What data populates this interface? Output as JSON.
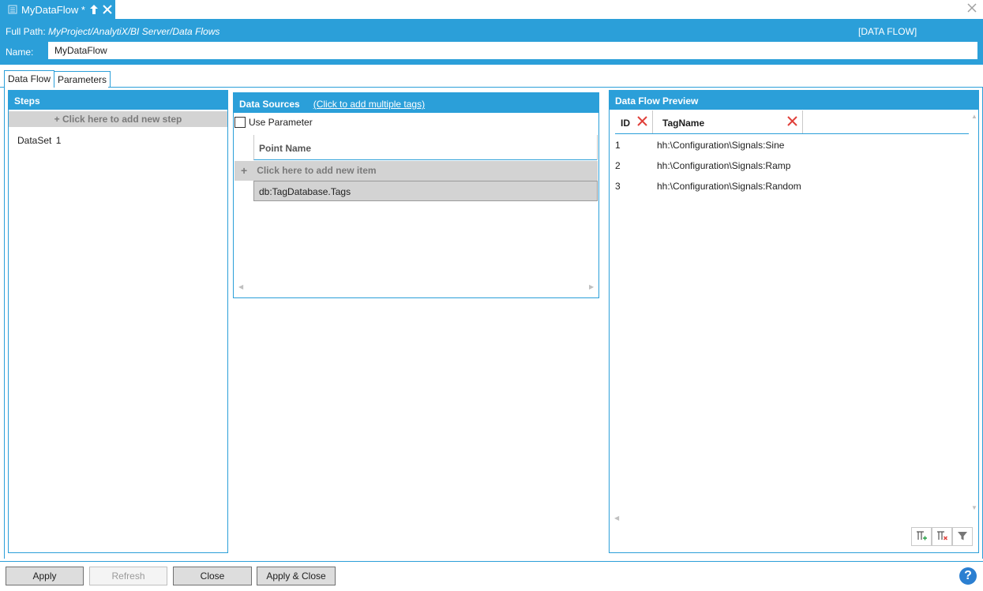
{
  "document_tab": {
    "title": "MyDataFlow *"
  },
  "header": {
    "full_path_label": "Full Path:",
    "full_path_value": "MyProject/AnalytiX/BI Server/Data Flows",
    "type_tag": "[DATA FLOW]",
    "name_label": "Name:",
    "name_value": "MyDataFlow"
  },
  "tabs": [
    {
      "label": "Data Flow",
      "active": true
    },
    {
      "label": "Parameters",
      "active": false
    }
  ],
  "steps": {
    "title": "Steps",
    "add_label": "+ Click here to add new step",
    "items": [
      {
        "label": "DataSet",
        "count": "1"
      }
    ]
  },
  "data_sources": {
    "title": "Data Sources",
    "link": "(Click to add multiple tags)",
    "use_parameter_label": "Use Parameter",
    "use_parameter_checked": false,
    "column_header": "Point Name",
    "add_item_label": "Click here to add new item",
    "rows": [
      "db:TagDatabase.Tags"
    ]
  },
  "preview": {
    "title": "Data Flow Preview",
    "columns": [
      "ID",
      "TagName"
    ],
    "rows": [
      {
        "id": "1",
        "tag": "hh:\\Configuration\\Signals:Sine"
      },
      {
        "id": "2",
        "tag": "hh:\\Configuration\\Signals:Ramp"
      },
      {
        "id": "3",
        "tag": "hh:\\Configuration\\Signals:Random"
      }
    ],
    "toolbar_icons": [
      "column-chooser-icon",
      "clear-columns-icon",
      "filter-icon"
    ]
  },
  "footer": {
    "apply": "Apply",
    "refresh": "Refresh",
    "close": "Close",
    "apply_close": "Apply & Close",
    "help": "?"
  },
  "colors": {
    "accent": "#2b9fd9",
    "delete_red": "#e0403a"
  }
}
